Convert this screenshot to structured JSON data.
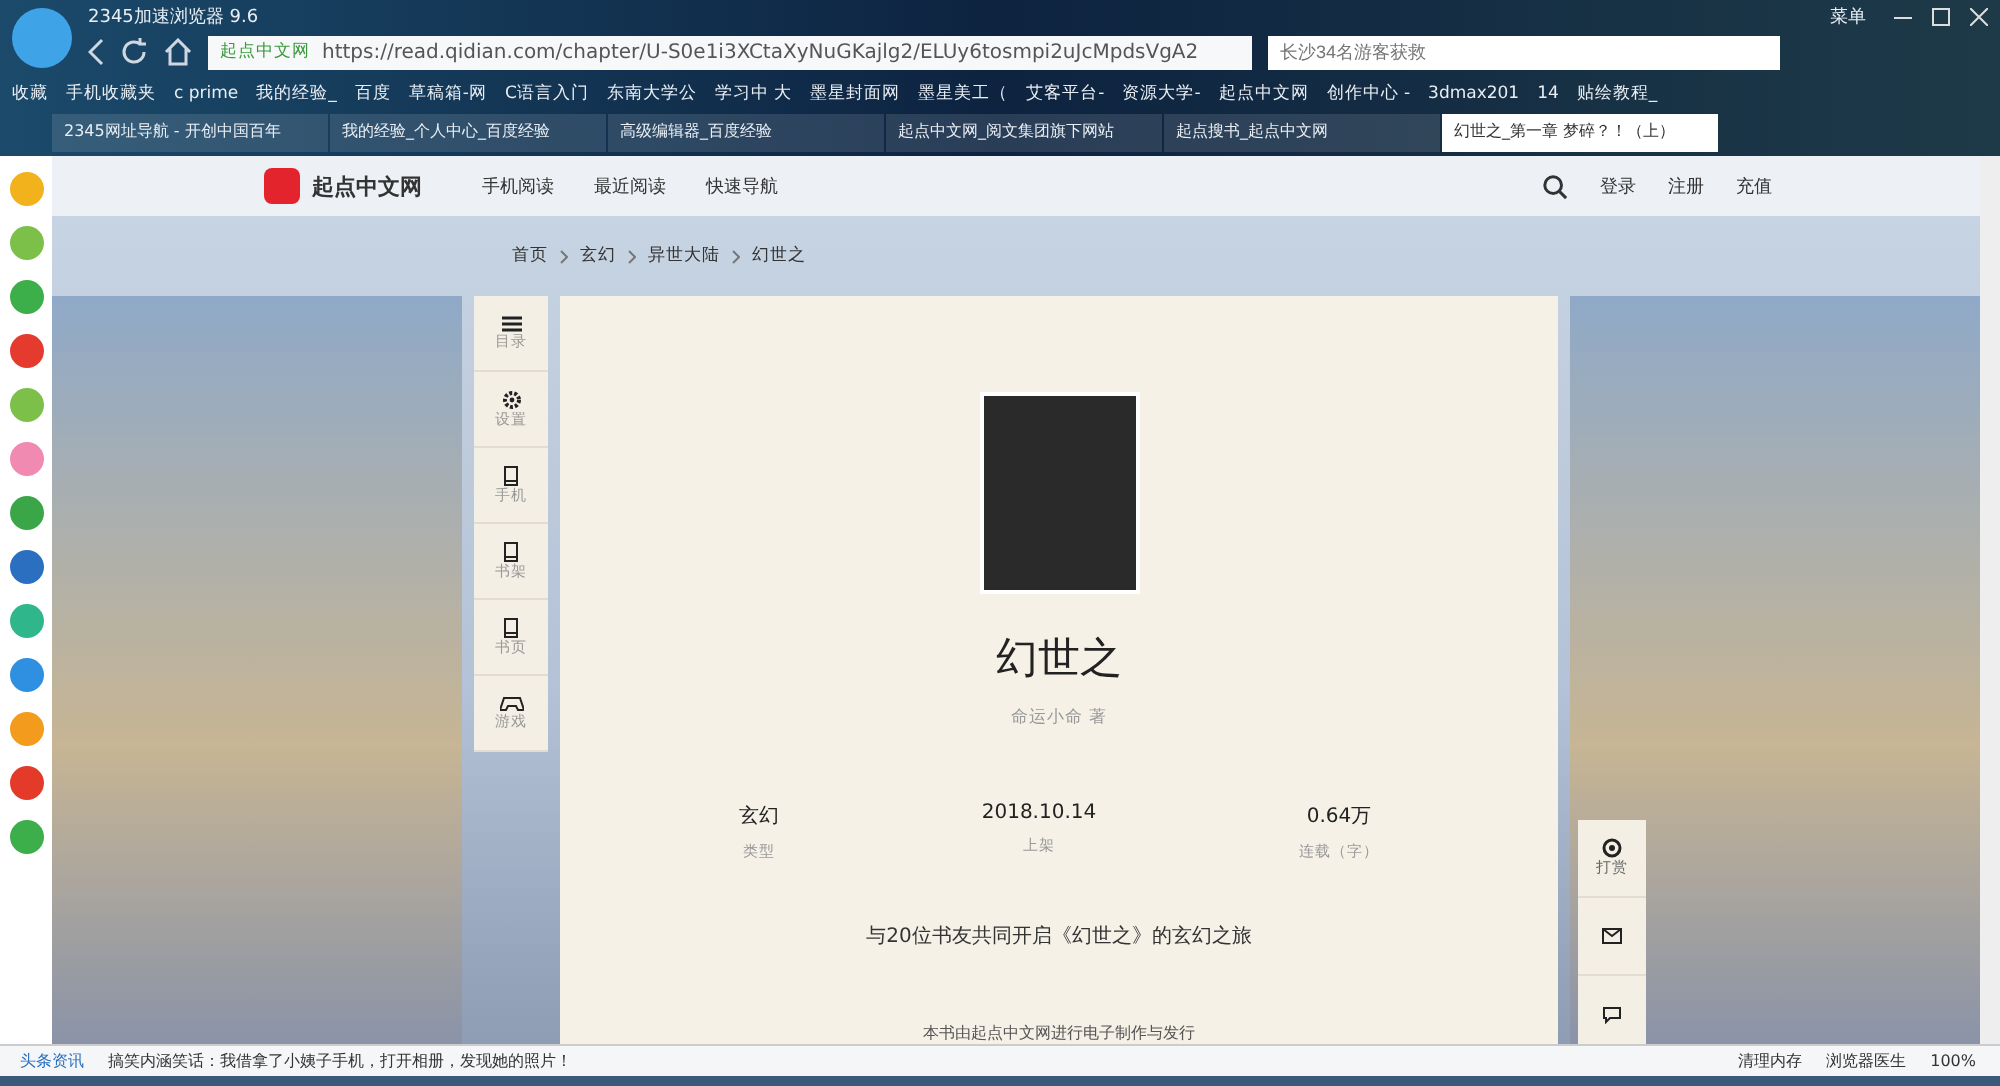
{
  "browser": {
    "title": "2345加速浏览器 9.6",
    "menu": "菜单",
    "site_badge": "起点中文网",
    "url": "https://read.qidian.com/chapter/U-S0e1i3XCtaXyNuGKajlg2/ELUy6tosmpi2uJcMpdsVgA2",
    "search_placeholder": "长沙34名游客获救"
  },
  "bookmarks": [
    "收藏",
    "手机收藏夹",
    "c prime",
    "我的经验_",
    "百度",
    "草稿箱-网",
    "C语言入门",
    "东南大学公",
    "学习中 大",
    "墨星封面网",
    "墨星美工（",
    "艾客平台-",
    "资源大学-",
    "起点中文网",
    "创作中心 -",
    "3dmax201",
    "14",
    "贴绘教程_"
  ],
  "tabs": [
    {
      "label": "2345网址导航 - 开创中国百年",
      "selected": false
    },
    {
      "label": "我的经验_个人中心_百度经验",
      "selected": false
    },
    {
      "label": "高级编辑器_百度经验",
      "selected": false
    },
    {
      "label": "起点中文网_阅文集团旗下网站",
      "selected": false
    },
    {
      "label": "起点搜书_起点中文网",
      "selected": false
    },
    {
      "label": "幻世之_第一章 梦碎？！（上）",
      "selected": true
    }
  ],
  "site_header": {
    "logo": "起点中文网",
    "nav": [
      "手机阅读",
      "最近阅读",
      "快速导航"
    ],
    "actions": [
      "登录",
      "注册",
      "充值"
    ]
  },
  "breadcrumb": [
    "首页",
    "玄幻",
    "异世大陆",
    "幻世之"
  ],
  "tools": [
    "目录",
    "设置",
    "手机",
    "书架",
    "书页",
    "游戏"
  ],
  "book": {
    "title": "幻世之",
    "author": "命运小命 著",
    "stats": [
      {
        "value": "玄幻",
        "label": "类型"
      },
      {
        "value": "2018.10.14",
        "label": "上架"
      },
      {
        "value": "0.64万",
        "label": "连载（字）"
      }
    ],
    "readers": "与20位书友共同开启《幻世之》的玄幻之旅",
    "publisher": "本书由起点中文网进行电子制作与发行"
  },
  "float_panel": {
    "tip": "打赏"
  },
  "status_bar": {
    "news_label": "头条资讯",
    "news": "搞笑内涵笑话：我借拿了小姨子手机，打开相册，发现她的照片！",
    "tools": [
      "清理内存",
      "浏览器医生"
    ],
    "zoom": "100%"
  }
}
